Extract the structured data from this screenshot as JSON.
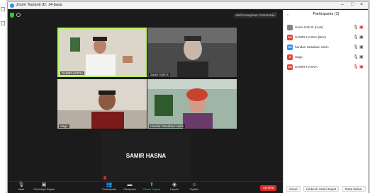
{
  "window": {
    "title": "Zoom Toplantı ID: 14-basa"
  },
  "meeting": {
    "view_label": "Aktif Konuşmacı Görünümü",
    "tiles": [
      {
        "name": "SAMIR HATNA"
      },
      {
        "name": "Samir Eski B"
      },
      {
        "name": "Sago"
      },
      {
        "name": "Handan Sasabaci sakin"
      },
      {
        "name": "",
        "big_name": "SAMIR HASNA"
      }
    ]
  },
  "toolbar": {
    "mute_label": "Mute",
    "video_label": "Görüntüyü Başlat",
    "participants_label": "Participants",
    "chat_label": "Görüşmek",
    "share_label": "Ekranı Paylaş",
    "record_label": "Kaydet",
    "reactions_label": "Tepkiler",
    "leave_label": "Ayrılma"
  },
  "participants_panel": {
    "title": "Participants (3)",
    "items": [
      {
        "name": "Samir Eski B (Host)",
        "initials": "",
        "color": "#8a7f75"
      },
      {
        "name": "SAMIR HASNA (Ben)",
        "initials": "SH",
        "color": "#e0453b"
      },
      {
        "name": "handan Sasabaci sakin",
        "initials": "HS",
        "color": "#2d8cff"
      },
      {
        "name": "Sago",
        "initials": "S",
        "color": "#e0453b"
      },
      {
        "name": "SAMIR HASNA",
        "initials": "SH",
        "color": "#e0453b"
      }
    ],
    "footer": {
      "invite_label": "Davet",
      "mute_all_label": "Herkesin Sesini Kapat",
      "more_label": "Daha fazlası"
    }
  }
}
